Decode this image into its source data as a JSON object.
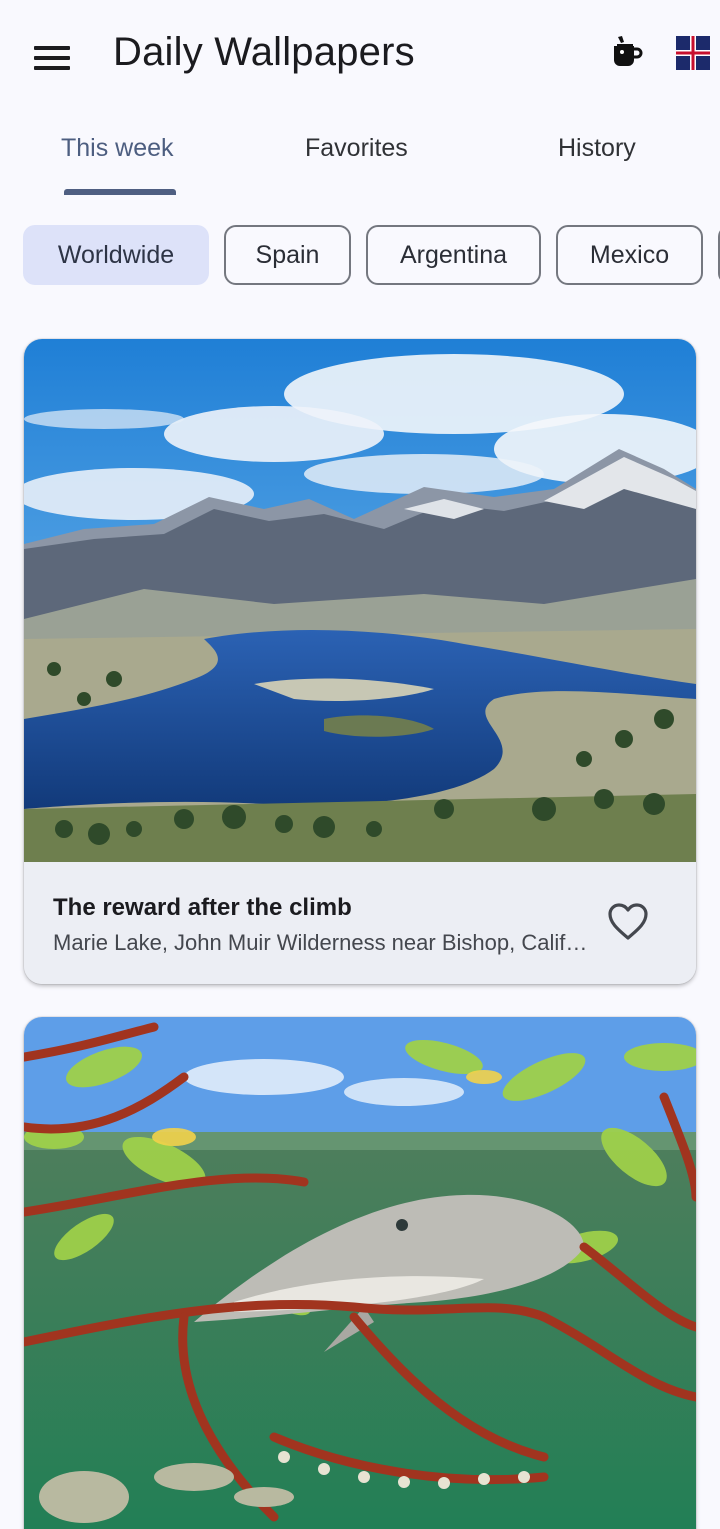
{
  "app": {
    "title": "Daily Wallpapers"
  },
  "icons": {
    "menu": "menu-icon",
    "coffee": "coffee-icon",
    "flag": "uk-flag-icon",
    "favorite": "heart-outline-icon"
  },
  "tabs": [
    {
      "label": "This week",
      "active": true
    },
    {
      "label": "Favorites",
      "active": false
    },
    {
      "label": "History",
      "active": false
    }
  ],
  "chips": [
    {
      "label": "Worldwide",
      "selected": true
    },
    {
      "label": "Spain",
      "selected": false
    },
    {
      "label": "Argentina",
      "selected": false
    },
    {
      "label": "Mexico",
      "selected": false
    }
  ],
  "wallpapers": [
    {
      "title": "The reward after the climb",
      "subtitle": "Marie Lake, John Muir Wilderness near Bishop, California"
    },
    {
      "image": "shark under mangrove roots"
    }
  ],
  "colors": {
    "accent": "#4f5f82",
    "chip_selected_bg": "#dde2f9",
    "background": "#f9f9fe"
  }
}
